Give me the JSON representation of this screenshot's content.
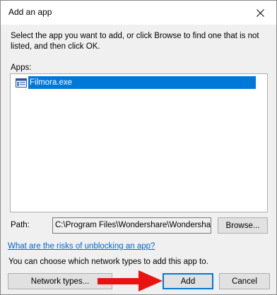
{
  "dialog": {
    "title": "Add an app",
    "description": "Select the app you want to add, or click Browse to find one that is not listed, and then click OK.",
    "apps_label": "Apps:",
    "apps": [
      {
        "name": "Filmora.exe",
        "selected": true,
        "icon": "app-window-icon"
      }
    ],
    "path_label": "Path:",
    "path_value": "C:\\Program Files\\Wondershare\\Wondershare",
    "browse_label": "Browse...",
    "risk_link": "What are the risks of unblocking an app?",
    "network_hint": "You can choose which network types to add this app to.",
    "network_types_label": "Network types...",
    "add_label": "Add",
    "cancel_label": "Cancel"
  },
  "annotation": {
    "arrow_icon": "red-arrow-icon",
    "arrow_color": "#e8130f"
  },
  "colors": {
    "selection": "#0078d7",
    "link": "#0066cc",
    "dialog_bg": "#f0f0f0"
  }
}
